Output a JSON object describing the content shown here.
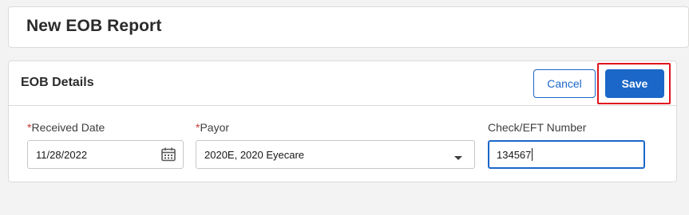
{
  "header": {
    "title": "New EOB Report"
  },
  "card": {
    "title": "EOB Details",
    "cancel_label": "Cancel",
    "save_label": "Save"
  },
  "fields": {
    "received_date": {
      "required_mark": "*",
      "label": "Received Date",
      "value": "11/28/2022"
    },
    "payor": {
      "required_mark": "*",
      "label": "Payor",
      "value": "2020E, 2020 Eyecare"
    },
    "check_eft": {
      "label": "Check/EFT Number",
      "value": "134567"
    }
  },
  "icons": {
    "calendar": "calendar-icon",
    "dropdown": "chevron-down-icon"
  },
  "colors": {
    "accent": "#1b67c9",
    "required": "#c23934",
    "highlight": "#e0141e"
  }
}
